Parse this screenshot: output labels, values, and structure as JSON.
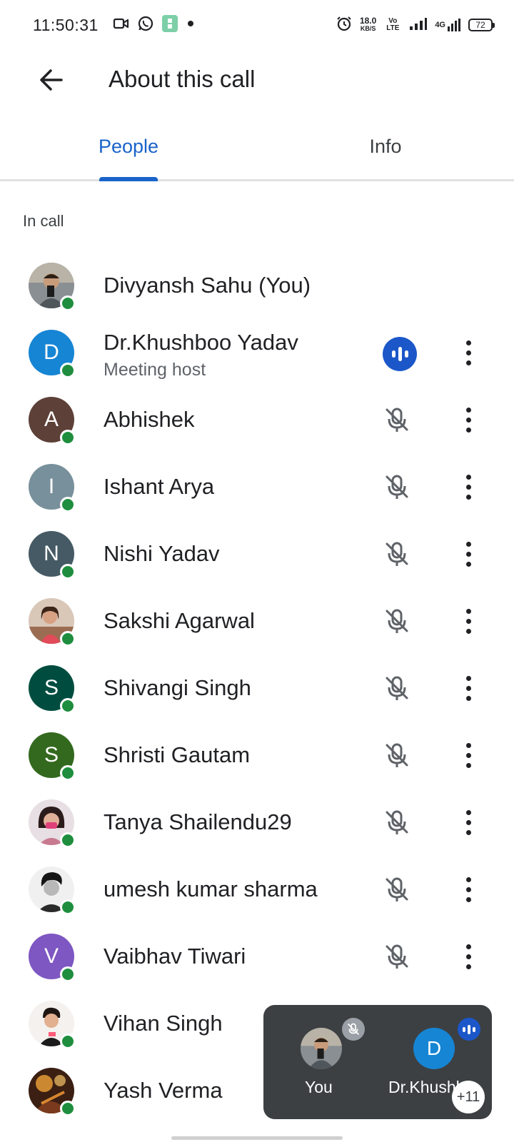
{
  "status_bar": {
    "time": "11:50:31",
    "net_speed": "18.0",
    "net_unit": "KB/S",
    "volte": "Vo LTE",
    "network_type": "4G",
    "battery": "72",
    "icons": [
      "video-icon",
      "whatsapp-icon",
      "app-icon",
      "dot-icon",
      "alarm-icon",
      "signal-icon",
      "signal-4g-icon",
      "battery-icon"
    ]
  },
  "app_bar": {
    "title": "About this call"
  },
  "tabs": [
    {
      "label": "People",
      "active": true
    },
    {
      "label": "Info",
      "active": false
    }
  ],
  "section_label": "In call",
  "participants": [
    {
      "name": "Divyansh Sahu (You)",
      "avatar_type": "photo",
      "mic": "none"
    },
    {
      "name": "Dr.Khushboo Yadav",
      "subtitle": "Meeting host",
      "initial": "D",
      "color": "#1685d4",
      "mic": "speaking"
    },
    {
      "name": "Abhishek",
      "initial": "A",
      "color": "#5d4037",
      "mic": "muted"
    },
    {
      "name": "Ishant Arya",
      "initial": "I",
      "color": "#78909c",
      "mic": "muted"
    },
    {
      "name": "Nishi Yadav",
      "initial": "N",
      "color": "#455a64",
      "mic": "muted"
    },
    {
      "name": "Sakshi Agarwal",
      "avatar_type": "photo",
      "mic": "muted"
    },
    {
      "name": "Shivangi Singh",
      "initial": "S",
      "color": "#004d40",
      "mic": "muted"
    },
    {
      "name": "Shristi Gautam",
      "initial": "S",
      "color": "#33691e",
      "mic": "muted"
    },
    {
      "name": "Tanya Shailendu29",
      "avatar_type": "photo",
      "mic": "muted"
    },
    {
      "name": "umesh kumar sharma",
      "avatar_type": "photo",
      "mic": "muted"
    },
    {
      "name": "Vaibhav Tiwari",
      "initial": "V",
      "color": "#7e57c2",
      "mic": "muted"
    },
    {
      "name": "Vihan Singh",
      "avatar_type": "photo",
      "mic": "muted"
    },
    {
      "name": "Yash Verma",
      "avatar_type": "photo",
      "mic": "muted"
    }
  ],
  "pip": {
    "you_label": "You",
    "other_label": "Dr.Khushboo",
    "other_initial": "D",
    "more_count": "+11"
  },
  "colors": {
    "accent": "#1a63c9",
    "online": "#1e8e3e",
    "speaking": "#1b57c9"
  }
}
